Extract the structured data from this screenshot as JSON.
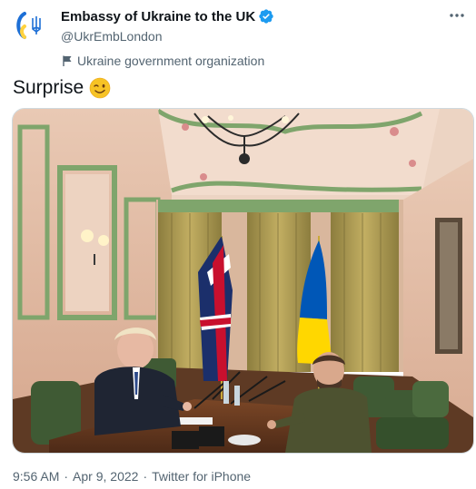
{
  "account": {
    "display_name": "Embassy of Ukraine to the UK",
    "handle": "@UkrEmbLondon",
    "affiliation_label": "Ukraine government organization",
    "verified": true,
    "avatar_icon": "ukraine-trident-logo",
    "verified_icon": "verified-badge-icon",
    "affiliation_icon": "flag-icon"
  },
  "tweet": {
    "text": "Surprise",
    "emoji": "winking-face-emoji"
  },
  "media": {
    "kind": "photo",
    "icon": "meeting-photo"
  },
  "meta": {
    "time": "9:56 AM",
    "separator": "·",
    "date": "Apr 9, 2022",
    "source": "Twitter for iPhone"
  },
  "colors": {
    "brand_blue": "#1d9bf0",
    "ukraine_blue": "#0057b7",
    "ukraine_yellow": "#ffd700",
    "secondary_text": "#536471",
    "primary_text": "#0f1419"
  }
}
